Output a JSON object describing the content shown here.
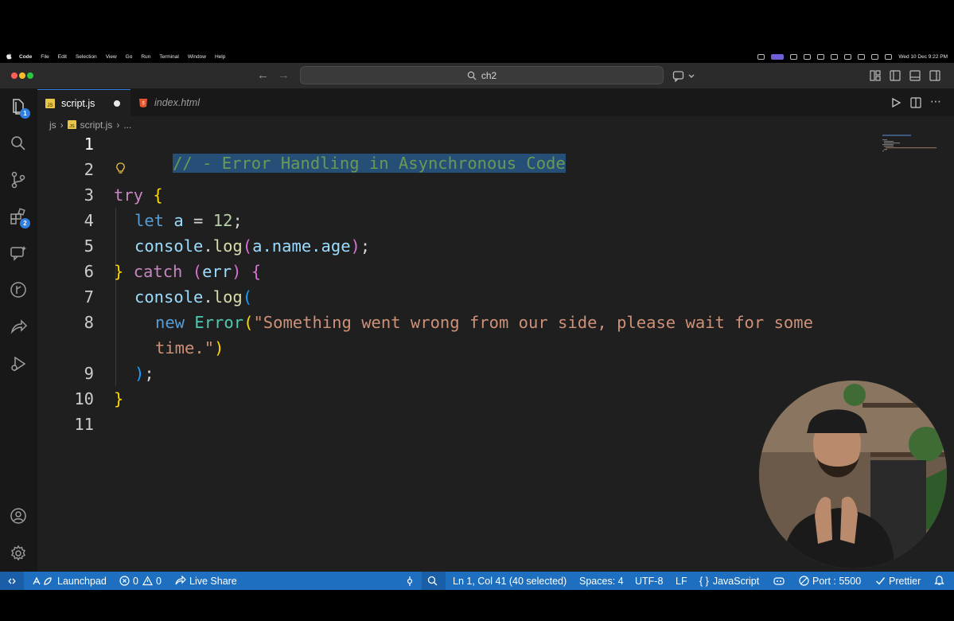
{
  "menubar": {
    "app_name": "Code",
    "items": [
      "File",
      "Edit",
      "Selection",
      "View",
      "Go",
      "Run",
      "Terminal",
      "Window",
      "Help"
    ],
    "clock": "Wed 10 Dec  9:22 PM"
  },
  "titlebar": {
    "search_text": "ch2"
  },
  "activity_badges": {
    "explorer": "1",
    "extensions": "2"
  },
  "tabs": [
    {
      "label": "script.js"
    },
    {
      "label": "index.html"
    }
  ],
  "breadcrumb": {
    "folder": "js",
    "file": "script.js",
    "more": "..."
  },
  "editor": {
    "line_numbers": [
      "1",
      "2",
      "3",
      "4",
      "5",
      "6",
      "7",
      "8",
      "9",
      "10",
      "11"
    ],
    "tokens": {
      "l1": "// - Error Handling in Asynchronous Code",
      "try": "try",
      "brace_open": "{",
      "let": "let",
      "a_var": "a",
      "eq": " = ",
      "num": "12",
      "semi": ";",
      "console": "console",
      "dot": ".",
      "log": "log",
      "paren_open": "(",
      "a_name_age": "a.name.age",
      "paren_close": ")",
      "brace_close": "}",
      "catch": "catch",
      "err": "err",
      "new": "new",
      "Error": "Error",
      "string1": "\"Something went wrong from our side, please wait for some",
      "string2": "time.\"",
      "close_paren_semi": ");"
    }
  },
  "statusbar": {
    "launchpad": "Launchpad",
    "errors": "0",
    "warnings": "0",
    "live_share": "Live Share",
    "cursor": "Ln 1, Col 41 (40 selected)",
    "spaces": "Spaces: 4",
    "encoding": "UTF-8",
    "eol": "LF",
    "language": "JavaScript",
    "port": "Port : 5500",
    "formatter": "Prettier"
  },
  "colors": {
    "accent": "#1e6fbf",
    "comment": "#6a9955",
    "keyword": "#569cd6",
    "control": "#c586c0",
    "string": "#ce9178",
    "number": "#b5cea8",
    "bracket_gold": "#ffd700",
    "bracket_pink": "#da70d6",
    "bracket_blue": "#179fff",
    "variable": "#9cdcfe",
    "function": "#dcdcaa",
    "class": "#4ec9b0",
    "selection": "#264f78"
  }
}
